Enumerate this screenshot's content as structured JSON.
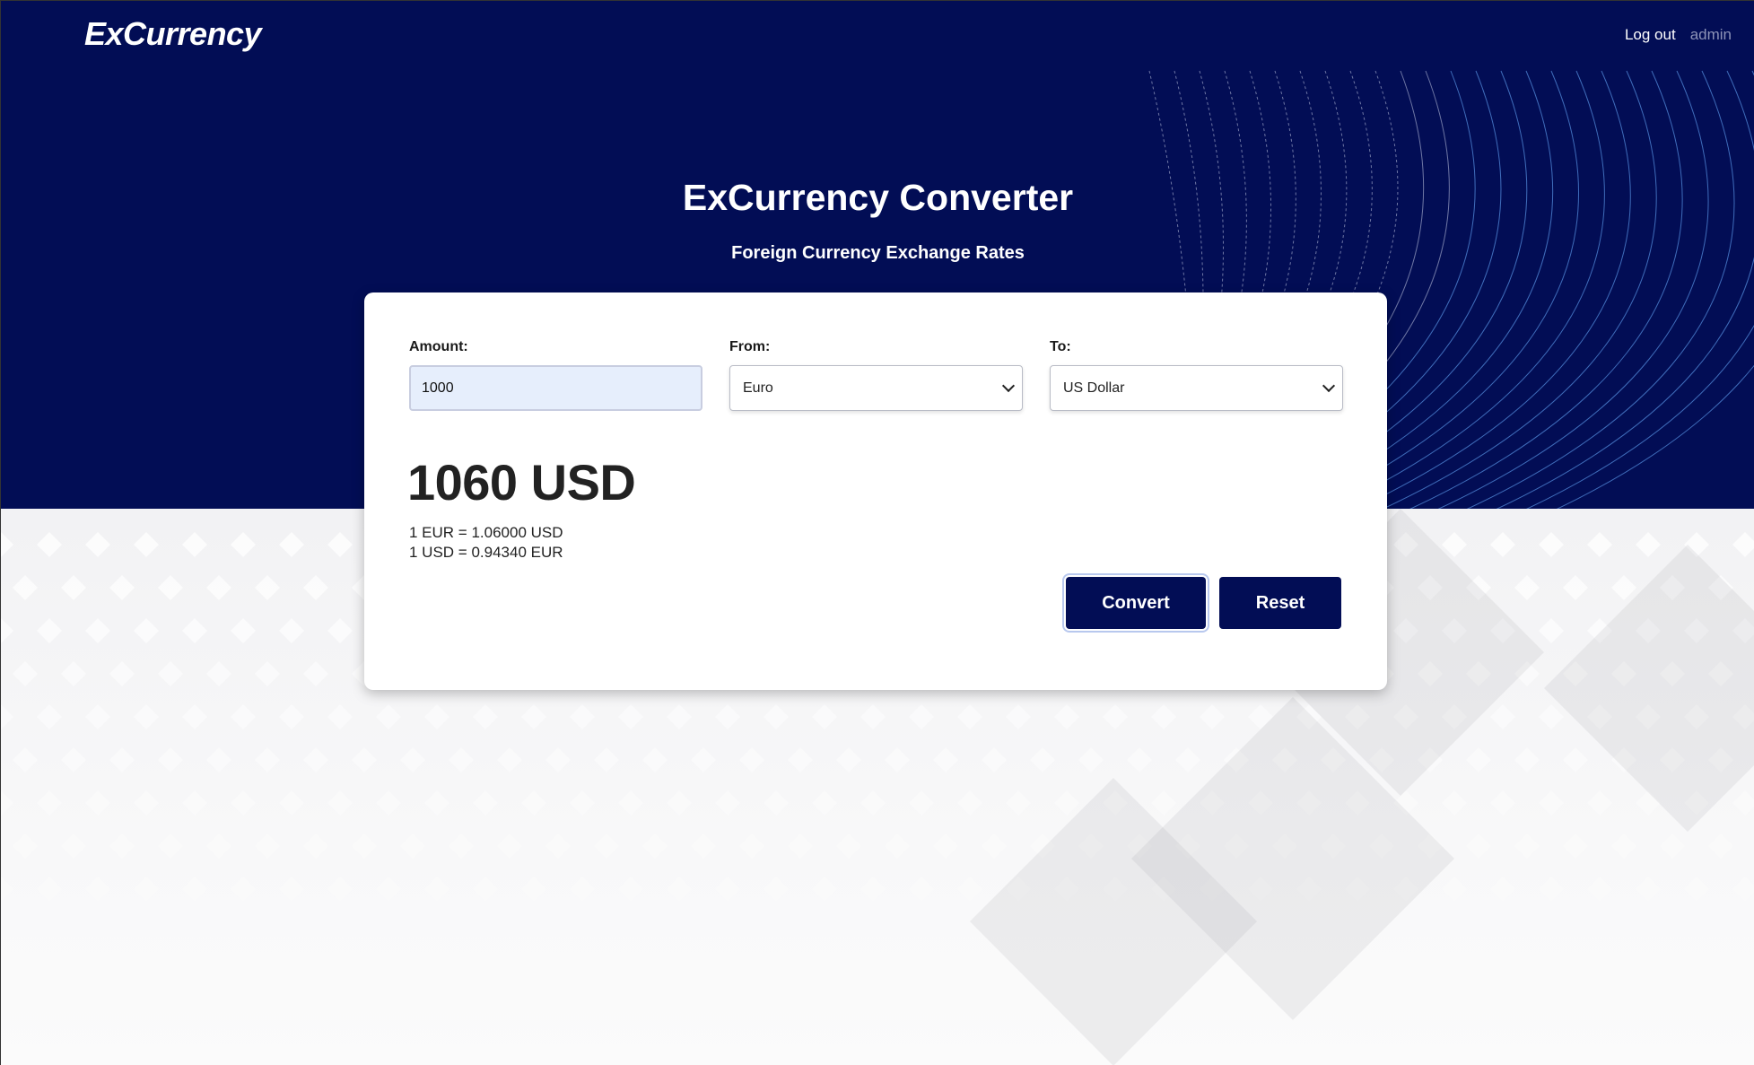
{
  "navbar": {
    "brand": "ExCurrency",
    "logout_label": "Log out",
    "username": "admin"
  },
  "hero": {
    "title": "ExCurrency Converter",
    "subtitle": "Foreign Currency Exchange Rates"
  },
  "form": {
    "amount_label": "Amount:",
    "amount_value": "1000",
    "from_label": "From:",
    "from_value": "Euro",
    "to_label": "To:",
    "to_value": "US Dollar"
  },
  "result": {
    "converted": "1060 USD",
    "rate_forward": "1 EUR = 1.06000 USD",
    "rate_inverse": "1 USD = 0.94340 EUR"
  },
  "buttons": {
    "convert_label": "Convert",
    "reset_label": "Reset"
  },
  "colors": {
    "primary": "#020d55",
    "white": "#ffffff"
  }
}
